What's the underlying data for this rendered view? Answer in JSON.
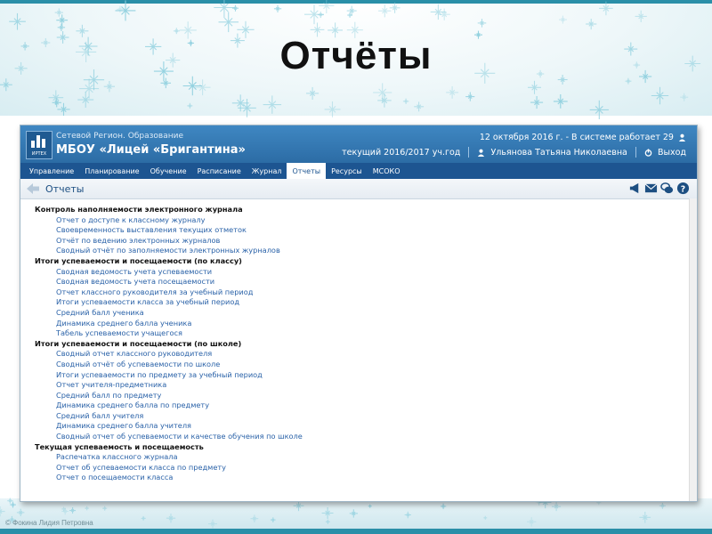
{
  "slide": {
    "title": "Отчёты",
    "copyright": "© Фокина Лидия Петровна"
  },
  "app": {
    "logo_caption": "ИРТЕХ",
    "subtitle": "Сетевой Регион. Образование",
    "school_name": "МБОУ «Лицей «Бригантина»",
    "date_status": "12 октября 2016 г. - В системе работает 29",
    "year": "текущий 2016/2017 уч.год",
    "user": "Ульянова Татьяна Николаевна",
    "exit": "Выход",
    "accent_color": "#2c6ca5",
    "menu": [
      {
        "label": "Управление"
      },
      {
        "label": "Планирование"
      },
      {
        "label": "Обучение"
      },
      {
        "label": "Расписание"
      },
      {
        "label": "Журнал"
      },
      {
        "label": "Отчеты"
      },
      {
        "label": "Ресурсы"
      },
      {
        "label": "МСОКО"
      }
    ],
    "active_menu": "Отчеты",
    "page_title": "Отчеты",
    "head_icons": [
      "megaphone-icon",
      "mail-icon",
      "chat-icon",
      "help-icon"
    ],
    "report_groups": [
      {
        "title": "Контроль наполняемости электронного журнала",
        "items": [
          "Отчет о доступе к классному журналу",
          "Своевременность выставления текущих отметок",
          "Отчёт по ведению электронных журналов",
          "Сводный отчёт по заполняемости электронных журналов"
        ]
      },
      {
        "title": "Итоги успеваемости и посещаемости (по классу)",
        "items": [
          "Сводная ведомость учета успеваемости",
          "Сводная ведомость учета посещаемости",
          "Отчет классного руководителя за учебный период",
          "Итоги успеваемости класса за учебный период",
          "Средний балл ученика",
          "Динамика среднего балла ученика",
          "Табель успеваемости учащегося"
        ]
      },
      {
        "title": "Итоги успеваемости и посещаемости (по школе)",
        "items": [
          "Сводный отчет классного руководителя",
          "Сводный отчёт об успеваемости по школе",
          "Итоги успеваемости по предмету за учебный период",
          "Отчет учителя-предметника",
          "Средний балл по предмету",
          "Динамика среднего балла по предмету",
          "Средний балл учителя",
          "Динамика среднего балла учителя",
          "Сводный отчет об успеваемости и качестве обучения по школе"
        ]
      },
      {
        "title": "Текущая успеваемость и посещаемость",
        "items": [
          "Распечатка классного журнала",
          "Отчет об успеваемости класса по предмету",
          "Отчет о посещаемости класса"
        ]
      }
    ]
  }
}
